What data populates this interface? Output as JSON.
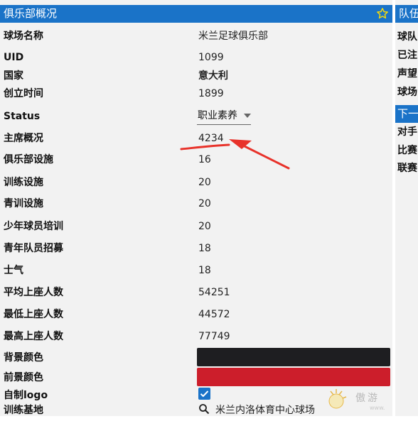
{
  "left_panel": {
    "title": "俱乐部概况",
    "rows": [
      {
        "label": "球场名称",
        "value": "米兰足球俱乐部"
      },
      {
        "label": "UID",
        "value": "1099"
      },
      {
        "label": "国家",
        "value": "意大利"
      },
      {
        "label": "创立时间",
        "value": "1899"
      },
      {
        "label": "Status",
        "value": "职业素养"
      },
      {
        "label": "主席概况",
        "value": "4234"
      },
      {
        "label": "俱乐部设施",
        "value": "16"
      },
      {
        "label": "训练设施",
        "value": "20"
      },
      {
        "label": "青训设施",
        "value": "20"
      },
      {
        "label": "少年球员培训",
        "value": "20"
      },
      {
        "label": "青年队员招募",
        "value": "18"
      },
      {
        "label": "士气",
        "value": "18"
      },
      {
        "label": "平均上座人数",
        "value": "54251"
      },
      {
        "label": "最低上座人数",
        "value": "44572"
      },
      {
        "label": "最高上座人数",
        "value": "77749"
      },
      {
        "label": "背景颜色",
        "value": ""
      },
      {
        "label": "前景颜色",
        "value": ""
      },
      {
        "label": "自制logo",
        "value": ""
      },
      {
        "label": "训练基地",
        "value": "米兰内洛体育中心球场"
      }
    ],
    "background_color": "#1e1e21",
    "foreground_color": "#cc1e2b",
    "logo_checked": true
  },
  "right_panel": {
    "title": "队伍",
    "labels": [
      "球队",
      "已注",
      "声望",
      "球场"
    ],
    "tab": "下一",
    "labels2": [
      "对手",
      "比赛",
      "联赛"
    ]
  },
  "colors": {
    "accent": "#1a73c8",
    "annotation": "#e8322a"
  },
  "icons": {
    "favorite": "star-icon",
    "search": "search-icon",
    "dropdown": "chevron-down-icon"
  }
}
